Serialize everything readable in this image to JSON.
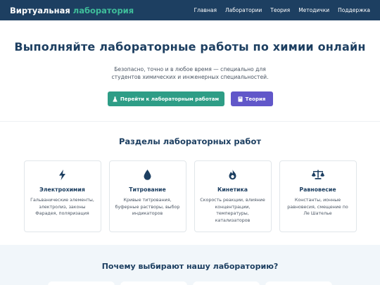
{
  "nav": {
    "brand_main": "Виртуальная",
    "brand_accent": "лаборатория",
    "links": [
      "Главная",
      "Лаборатории",
      "Теория",
      "Методички",
      "Поддержка"
    ]
  },
  "hero": {
    "title": "Выполняйте лабораторные работы по химии онлайн",
    "subtitle": "Безопасно, точно и в любое время — специально для студентов химических и инженерных специальностей.",
    "primary_button": "Перейти к лабораторным работам",
    "secondary_button": "Теория"
  },
  "sections": {
    "title": "Разделы лабораторных работ",
    "cards": [
      {
        "icon": "lightning-icon",
        "title": "Электрохимия",
        "desc": "Гальванические элементы, электролиз, законы Фарадея, поляризация"
      },
      {
        "icon": "droplet-icon",
        "title": "Титрование",
        "desc": "Кривые титрования, буферные растворы, выбор индикаторов"
      },
      {
        "icon": "flame-icon",
        "title": "Кинетика",
        "desc": "Скорость реакции, влияние концентрации, температуры, катализаторов"
      },
      {
        "icon": "balance-scale-icon",
        "title": "Равновесие",
        "desc": "Константы, ионные равновесия, смещение по Ле Шателье"
      }
    ]
  },
  "why": {
    "title": "Почему выбирают нашу лабораторию?"
  },
  "colors": {
    "navy": "#1d3f61",
    "teal": "#2e9d86",
    "purple": "#6157c9"
  }
}
